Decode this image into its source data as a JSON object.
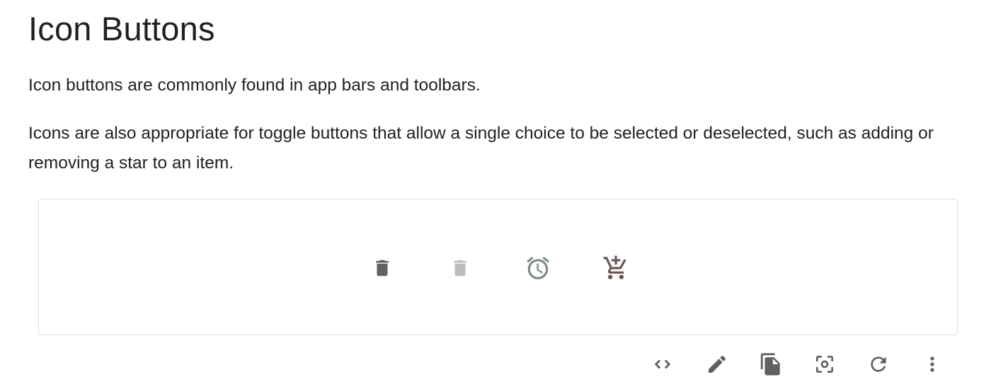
{
  "heading": "Icon Buttons",
  "paragraphs": [
    "Icon buttons are commonly found in app bars and toolbars.",
    "Icons are also appropriate for toggle buttons that allow a single choice to be selected or deselected, such as adding or removing a star to an item."
  ],
  "demo": {
    "buttons": [
      {
        "icon": "delete-icon",
        "state": "enabled"
      },
      {
        "icon": "delete-icon",
        "state": "disabled"
      },
      {
        "icon": "alarm-icon",
        "state": "enabled"
      },
      {
        "icon": "add-shopping-cart-icon",
        "state": "enabled"
      }
    ]
  },
  "toolbar": {
    "buttons": [
      {
        "icon": "code-icon"
      },
      {
        "icon": "edit-icon"
      },
      {
        "icon": "copy-icon"
      },
      {
        "icon": "screenshot-icon"
      },
      {
        "icon": "refresh-icon"
      },
      {
        "icon": "more-vert-icon"
      }
    ]
  },
  "colors": {
    "text": "#212121",
    "icon_default": "#757575",
    "icon_disabled": "#bdbdbd",
    "icon_secondary": "#7b8b88",
    "icon_primary": "#6b5556",
    "border": "#dcdcdc"
  }
}
